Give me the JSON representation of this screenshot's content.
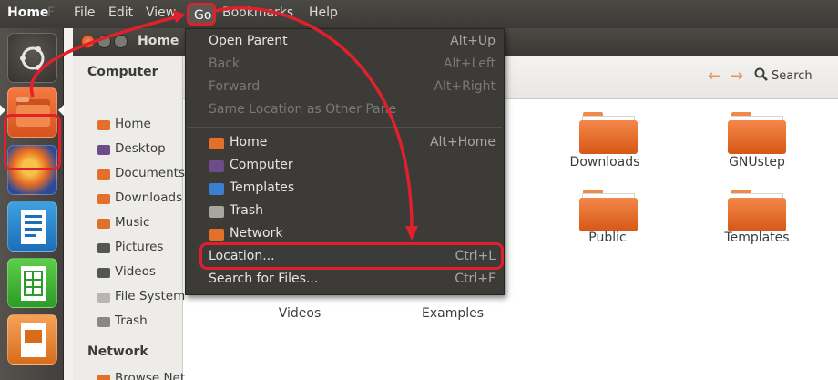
{
  "topbar": {
    "app_name": "Home",
    "app_name_ghost": "F",
    "menus": [
      "File",
      "Edit",
      "View",
      "Go",
      "Bookmarks",
      "Help"
    ]
  },
  "launcher": {
    "items": [
      "ubuntu-dash-icon",
      "files-icon",
      "firefox-icon",
      "writer-icon",
      "calc-icon",
      "impress-icon"
    ]
  },
  "window": {
    "title": "Home",
    "search_label": "Search"
  },
  "sidebar": {
    "computer_heading": "Computer",
    "items": [
      {
        "label": "Home",
        "icon": "home-folder-icon",
        "color": "#e26f2a"
      },
      {
        "label": "Desktop",
        "icon": "desktop-icon",
        "color": "#6e4c8a"
      },
      {
        "label": "Documents",
        "icon": "documents-icon",
        "color": "#e26f2a"
      },
      {
        "label": "Downloads",
        "icon": "downloads-icon",
        "color": "#e26f2a"
      },
      {
        "label": "Music",
        "icon": "music-icon",
        "color": "#e26f2a"
      },
      {
        "label": "Pictures",
        "icon": "pictures-icon",
        "color": "#555555"
      },
      {
        "label": "Videos",
        "icon": "videos-icon",
        "color": "#555555"
      },
      {
        "label": "File System",
        "icon": "filesystem-icon",
        "color": "#b8b6b2"
      },
      {
        "label": "Trash",
        "icon": "trash-icon",
        "color": "#8a8884"
      }
    ],
    "network_heading": "Network",
    "network_items": [
      {
        "label": "Browse Net…",
        "icon": "network-icon",
        "color": "#e26f2a"
      }
    ]
  },
  "content": {
    "folders": [
      {
        "label": "Downloads"
      },
      {
        "label": "GNUstep"
      },
      {
        "label": "Public"
      },
      {
        "label": "Templates"
      },
      {
        "label": "Videos"
      },
      {
        "label": "Examples"
      }
    ]
  },
  "go_menu": {
    "items": [
      {
        "label": "Open Parent",
        "shortcut": "Alt+Up",
        "enabled": true
      },
      {
        "label": "Back",
        "shortcut": "Alt+Left",
        "enabled": false
      },
      {
        "label": "Forward",
        "shortcut": "Alt+Right",
        "enabled": false
      },
      {
        "label": "Same Location as Other Pane",
        "shortcut": "",
        "enabled": false
      }
    ],
    "places": [
      {
        "label": "Home",
        "shortcut": "Alt+Home",
        "icon": "home-folder-icon"
      },
      {
        "label": "Computer",
        "shortcut": "",
        "icon": "computer-icon"
      },
      {
        "label": "Templates",
        "shortcut": "",
        "icon": "templates-icon"
      },
      {
        "label": "Trash",
        "shortcut": "",
        "icon": "trash-icon"
      },
      {
        "label": "Network",
        "shortcut": "",
        "icon": "network-icon"
      }
    ],
    "location": {
      "label": "Location...",
      "shortcut": "Ctrl+L"
    },
    "search": {
      "label": "Search for Files...",
      "shortcut": "Ctrl+F"
    }
  },
  "colors": {
    "annotation": "#e0202c",
    "accent": "#dd4814",
    "menu_bg": "#3c3b37"
  }
}
